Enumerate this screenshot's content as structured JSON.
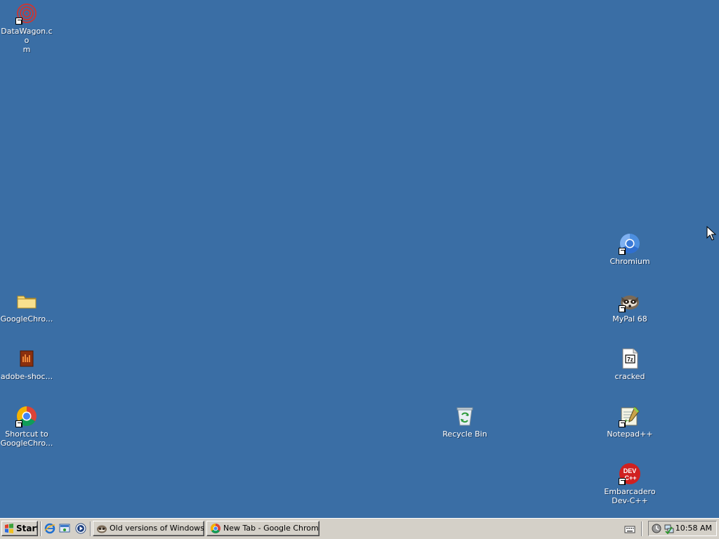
{
  "desktop": {
    "icons": [
      {
        "label": "DataWagon.co\nm",
        "icon": "datawagon-icon",
        "shortcut": true
      },
      {
        "label": "GoogleChro...",
        "icon": "folder-icon",
        "shortcut": false
      },
      {
        "label": "adobe-shoc...",
        "icon": "adobe-shockwave-icon",
        "shortcut": false
      },
      {
        "label": "Shortcut to\nGoogleChro...",
        "icon": "chrome-icon",
        "shortcut": true
      },
      {
        "label": "Recycle Bin",
        "icon": "recycle-bin-icon",
        "shortcut": false
      },
      {
        "label": "Chromium",
        "icon": "chromium-icon",
        "shortcut": true
      },
      {
        "label": "MyPal 68",
        "icon": "mypal-icon",
        "shortcut": true
      },
      {
        "label": "cracked",
        "icon": "7z-file-icon",
        "shortcut": false
      },
      {
        "label": "Notepad++",
        "icon": "notepad-plus-plus-icon",
        "shortcut": true
      },
      {
        "label": "Embarcadero\nDev-C++",
        "icon": "dev-cpp-icon",
        "shortcut": true
      }
    ]
  },
  "taskbar": {
    "start_label": "Start",
    "quick_launch": [
      "internet-explorer-icon",
      "show-desktop-icon",
      "media-player-icon"
    ],
    "tasks": [
      {
        "label": "Old versions of Windows...",
        "icon": "mypal-icon",
        "active": false
      },
      {
        "label": "New Tab - Google Chrome",
        "icon": "chrome-icon",
        "active": false
      }
    ],
    "tray": {
      "icons": [
        "keyboard-icon",
        "security-icon",
        "network-icon"
      ],
      "clock": "10:58 AM"
    }
  },
  "colors": {
    "desktop_background": "#3a6ea5",
    "taskbar": "#d4d0c8"
  }
}
